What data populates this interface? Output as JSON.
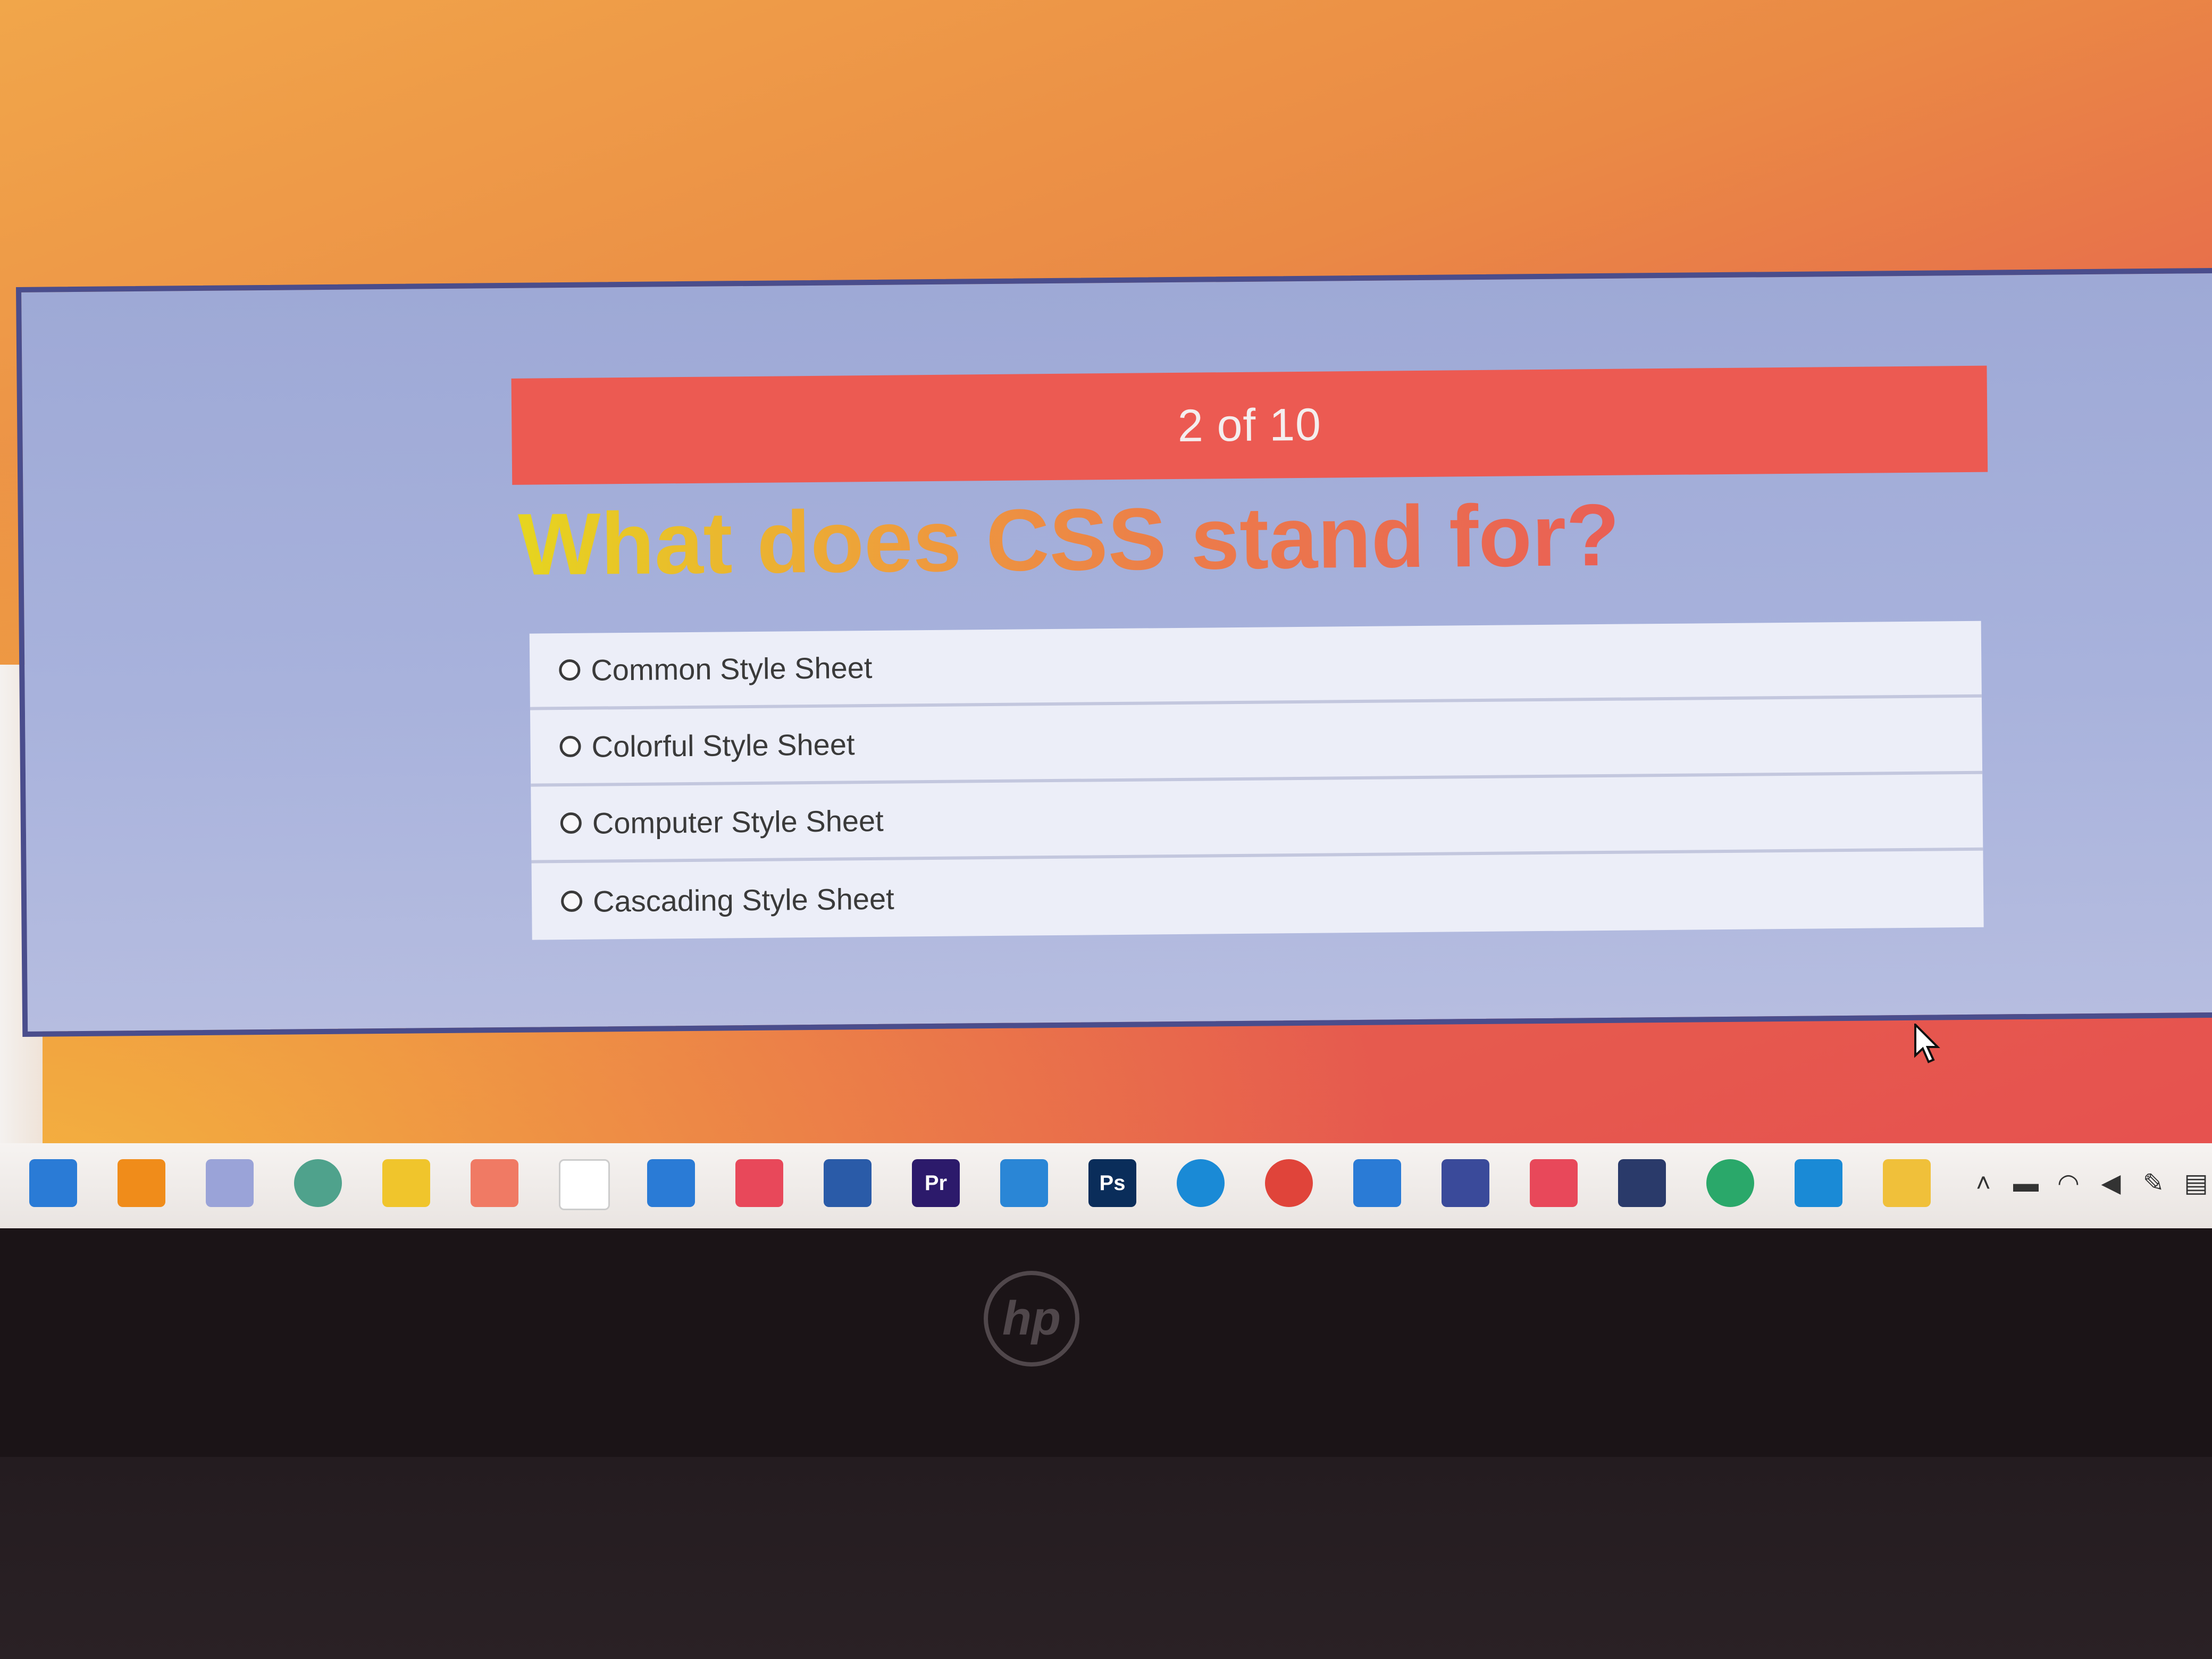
{
  "quiz": {
    "progress": "2 of 10",
    "question": "What does CSS stand for?",
    "options": [
      "Common Style Sheet",
      "Colorful Style Sheet",
      "Computer Style Sheet",
      "Cascading Style Sheet"
    ]
  },
  "colors": {
    "background_gradient": [
      "#f1a64a",
      "#e6504f"
    ],
    "panel": "#a8b2dc",
    "progress_bar": "#ec5a52",
    "question_gradient": [
      "#e6d51f",
      "#e95f55"
    ]
  },
  "taskbar": {
    "apps": [
      {
        "icon": "vscode-icon",
        "color": "#2a7bd6"
      },
      {
        "icon": "vlc-icon",
        "color": "#f08c1a"
      },
      {
        "icon": "app-icon",
        "color": "#9aa3d8"
      },
      {
        "icon": "chatgpt-icon",
        "color": "#4fa28c"
      },
      {
        "icon": "paint-icon",
        "color": "#f0c52c"
      },
      {
        "icon": "xampp-icon",
        "color": "#f07a64"
      },
      {
        "icon": "file-icon",
        "color": "#ffffff"
      },
      {
        "icon": "app-icon",
        "color": "#2a7bd6"
      },
      {
        "icon": "app-icon",
        "color": "#e8485a"
      },
      {
        "icon": "virtualbox-icon",
        "color": "#2a5ba8"
      },
      {
        "icon": "premiere-icon",
        "color": "#2c1a6b",
        "text": "Pr"
      },
      {
        "icon": "app-icon",
        "color": "#2a86d6"
      },
      {
        "icon": "photoshop-icon",
        "color": "#0a2d5a",
        "text": "Ps"
      },
      {
        "icon": "edge-icon",
        "color": "#1a8ad6"
      },
      {
        "icon": "chrome-icon",
        "color": "#e0443a"
      },
      {
        "icon": "mail-icon",
        "color": "#2a7bd6"
      },
      {
        "icon": "toolbox-icon",
        "color": "#3a4a9a"
      },
      {
        "icon": "app-icon",
        "color": "#e8485a"
      },
      {
        "icon": "app-icon",
        "color": "#2a3a6a"
      },
      {
        "icon": "whatsapp-icon",
        "color": "#2aa86a"
      },
      {
        "icon": "app-icon",
        "color": "#1a8ad6"
      },
      {
        "icon": "folder-icon",
        "color": "#f0c03a"
      }
    ],
    "tray": [
      "chevron-up-icon",
      "battery-icon",
      "wifi-icon",
      "volume-icon",
      "pen-icon",
      "keyboard-icon"
    ]
  },
  "laptop_logo": "hp"
}
